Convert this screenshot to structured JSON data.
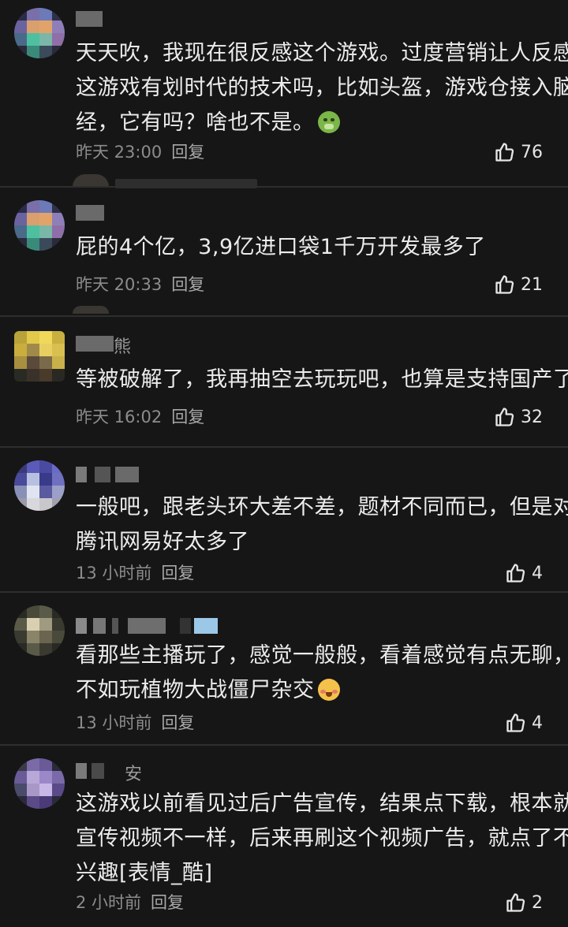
{
  "comments": [
    {
      "username_tail": "",
      "lines": [
        "天天吹，我现在很反感这个游戏。过度营销让人反感，",
        "这游戏有划时代的技术吗，比如头盔，游戏仓接入脑神",
        "经，它有吗？啥也不是。"
      ],
      "emoji": "sick-face-emoji",
      "time": "昨天 23:00",
      "reply": "回复",
      "likes": "76"
    },
    {
      "username_tail": "",
      "lines": [
        "屁的4个亿，3,9亿进口袋1千万开发最多了"
      ],
      "time": "昨天 20:33",
      "reply": "回复",
      "likes": "21"
    },
    {
      "username_tail": "熊",
      "lines": [
        "等被破解了，我再抽空去玩玩吧，也算是支持国产了。"
      ],
      "time": "昨天 16:02",
      "reply": "回复",
      "likes": "32"
    },
    {
      "username_tail": "",
      "lines": [
        "一般吧，跟老头环大差不差，题材不同而已，但是对比",
        "腾讯网易好太多了"
      ],
      "time": "13 小时前",
      "reply": "回复",
      "likes": "4"
    },
    {
      "username_tail": "",
      "lines": [
        "看那些主播玩了，感觉一般般，看着感觉有点无聊，还",
        "不如玩植物大战僵尸杂交"
      ],
      "emoji": "blushing-face-emoji",
      "time": "13 小时前",
      "reply": "回复",
      "likes": "4"
    },
    {
      "username_tail": "安",
      "lines": [
        "这游戏以前看见过后广告宣传，结果点下载，根本就跟",
        "宣传视频不一样，后来再刷这个视频广告，就点了不感",
        "兴趣[表情_酷]"
      ],
      "time": "2 小时前",
      "reply": "回复",
      "likes": "2"
    }
  ],
  "colors": {
    "background": "#161616",
    "text": "#ececec",
    "meta": "#8c8c8c",
    "divider": "#2e2e2e"
  },
  "icons": {
    "like": "thumbs-up-icon"
  }
}
